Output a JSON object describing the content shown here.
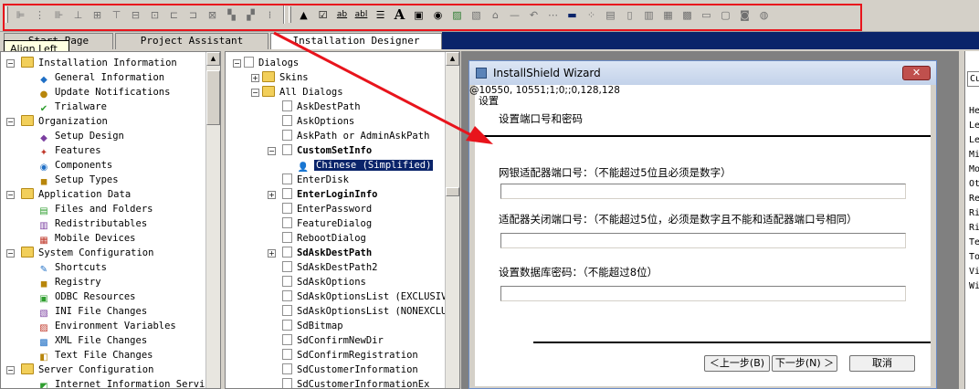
{
  "toolbar": {
    "tooltip": "Align Left",
    "align_buttons": [
      "align-left-icon",
      "align-center-icon",
      "align-right-icon",
      "align-bottom-icon",
      "align-middle-icon",
      "align-top-icon",
      "space-across-icon",
      "space-down-icon",
      "center-horizontal-icon",
      "center-vertical-icon",
      "make-same-size-icon",
      "bring-to-front-icon",
      "send-to-back-icon",
      "grid-icon"
    ],
    "control_buttons": [
      "select-pointer-icon",
      "checkbox-icon",
      "editfield-icon",
      "textarea-icon",
      "listbox-icon",
      "text-label-icon",
      "groupbox-icon",
      "radio-button-icon",
      "bitmap-icon",
      "icon-control-icon",
      "pushbutton-icon",
      "line-icon",
      "scrollbar-icon",
      "slider-icon",
      "progress-icon",
      "listview-icon",
      "treeview-icon",
      "richedit-icon",
      "combobox-icon",
      "hyperlink-icon",
      "billboard-icon",
      "tab-icon",
      "custom-icon",
      "activex-icon",
      "ip-address-icon"
    ],
    "glyphs": {
      "select": "▲",
      "check": "☑",
      "ab": "ab",
      "abl": "abl",
      "A": "A"
    }
  },
  "tabs": {
    "start_page": "Start Page",
    "project_assistant": "Project Assistant",
    "installation_designer": "Installation Designer"
  },
  "left_tree": {
    "groups": [
      {
        "label": "Installation Information",
        "items": [
          "General Information",
          "Update Notifications",
          "Trialware"
        ]
      },
      {
        "label": "Organization",
        "items": [
          "Setup Design",
          "Features",
          "Components",
          "Setup Types"
        ]
      },
      {
        "label": "Application Data",
        "items": [
          "Files and Folders",
          "Redistributables",
          "Mobile Devices"
        ]
      },
      {
        "label": "System Configuration",
        "items": [
          "Shortcuts",
          "Registry",
          "ODBC Resources",
          "INI File Changes",
          "Environment Variables",
          "XML File Changes",
          "Text File Changes"
        ]
      },
      {
        "label": "Server Configuration",
        "items": [
          "Internet Information Servic"
        ]
      }
    ]
  },
  "dialog_tree": {
    "root": "Dialogs",
    "skins": "Skins",
    "all_dialogs": "All Dialogs",
    "items": [
      {
        "label": "AskDestPath",
        "bold": false,
        "expander": false
      },
      {
        "label": "AskOptions",
        "bold": false,
        "expander": false
      },
      {
        "label": "AskPath or AdminAskPath",
        "bold": false,
        "expander": false
      },
      {
        "label": "CustomSetInfo",
        "bold": true,
        "expander": "minus"
      },
      {
        "label": "Chinese (Simplified)",
        "bold": false,
        "expander": false,
        "child": true,
        "selected": true
      },
      {
        "label": "EnterDisk",
        "bold": false,
        "expander": false
      },
      {
        "label": "EnterLoginInfo",
        "bold": true,
        "expander": "plus"
      },
      {
        "label": "EnterPassword",
        "bold": false,
        "expander": false
      },
      {
        "label": "FeatureDialog",
        "bold": false,
        "expander": false
      },
      {
        "label": "RebootDialog",
        "bold": false,
        "expander": false
      },
      {
        "label": "SdAskDestPath",
        "bold": true,
        "expander": "plus"
      },
      {
        "label": "SdAskDestPath2",
        "bold": false,
        "expander": false
      },
      {
        "label": "SdAskOptions",
        "bold": false,
        "expander": false
      },
      {
        "label": "SdAskOptionsList (EXCLUSIVE",
        "bold": false,
        "expander": false
      },
      {
        "label": "SdAskOptionsList (NONEXCLUS",
        "bold": false,
        "expander": false
      },
      {
        "label": "SdBitmap",
        "bold": false,
        "expander": false
      },
      {
        "label": "SdConfirmNewDir",
        "bold": false,
        "expander": false
      },
      {
        "label": "SdConfirmRegistration",
        "bold": false,
        "expander": false
      },
      {
        "label": "SdCustomerInformation",
        "bold": false,
        "expander": false
      },
      {
        "label": "SdCustomerInformationEx",
        "bold": false,
        "expander": false
      }
    ]
  },
  "wizard": {
    "title": "InstallShield Wizard",
    "close": "✕",
    "res_id": "@10550, 10551;1;0;;0,128,128",
    "heading_overlap": "设置",
    "subtitle": "设置端口号和密码",
    "label_port": "网银适配器端口号：（不能超过5位且必须是数字）",
    "label_close_port": "适配器关闭端口号：（不能超过5位，必须是数字且不能和适配器端口号相同）",
    "label_db_password": "设置数据库密码：（不能超过8位）",
    "btn_back": "＜上一步(B)",
    "btn_next": "下一步(N) ＞",
    "btn_cancel": "取消"
  },
  "properties": {
    "combo": "Cu",
    "rows": [
      "He",
      "Le",
      "Le",
      "Mi",
      "Mo",
      "Ot",
      "Re",
      "Ri",
      "Ri",
      "Te",
      "To",
      "Vi",
      "Wi"
    ]
  },
  "colors": {
    "highlight_box": "#e8141c",
    "selection": "#0a246a",
    "folder": "#f2cf5a"
  }
}
